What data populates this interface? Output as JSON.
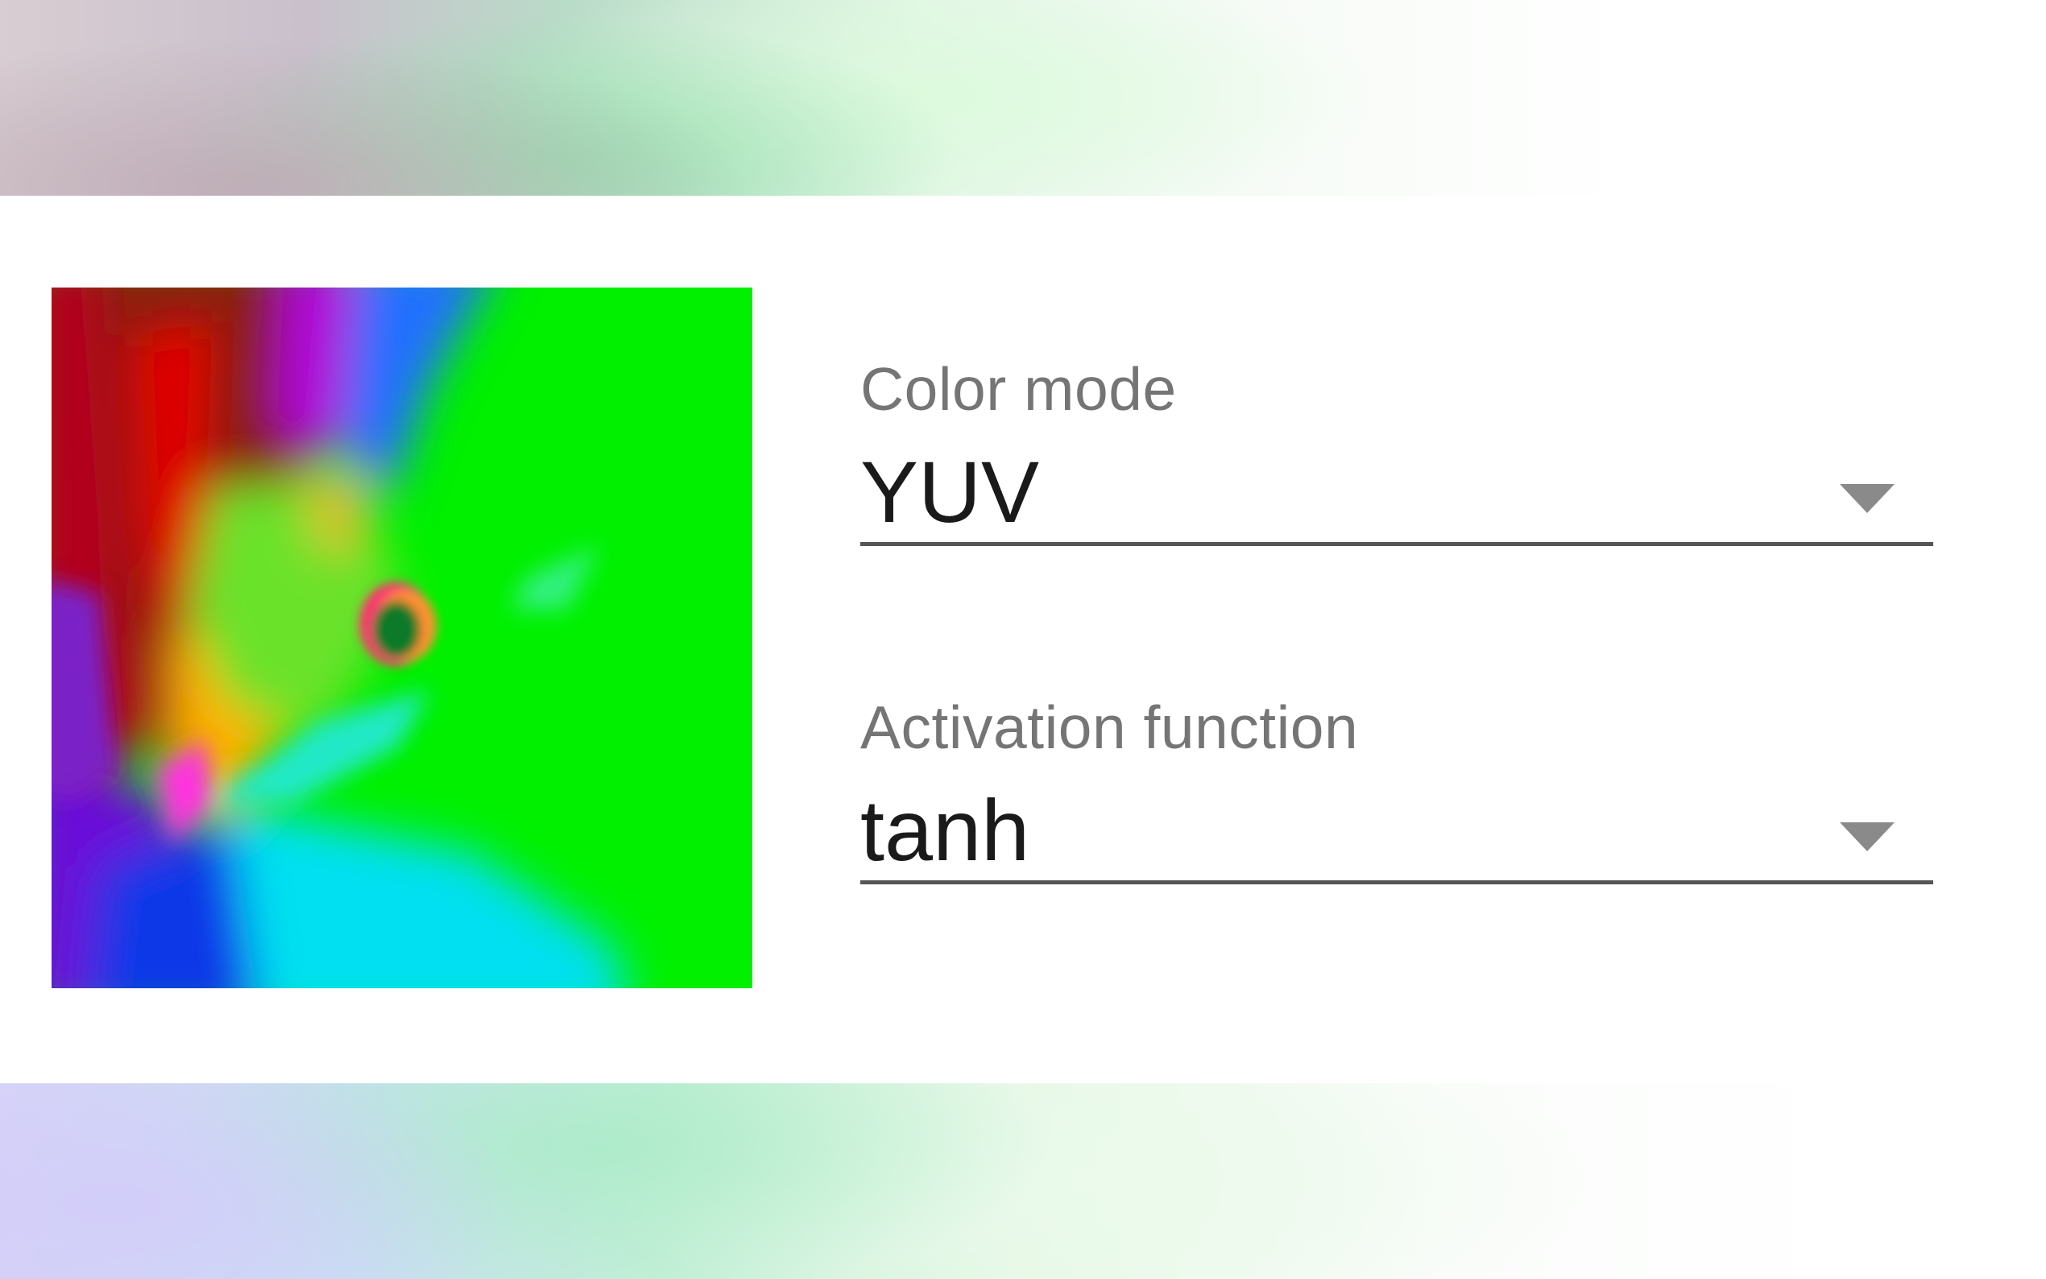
{
  "color_mode": {
    "label": "Color mode",
    "value": "YUV",
    "icon": "chevron-down-icon"
  },
  "activation_function": {
    "label": "Activation function",
    "value": "tanh",
    "icon": "chevron-down-icon"
  },
  "colors": {
    "label_text": "#757575",
    "value_text": "#1a1a1a",
    "underline": "#555555",
    "caret": "#8a8a8a"
  }
}
